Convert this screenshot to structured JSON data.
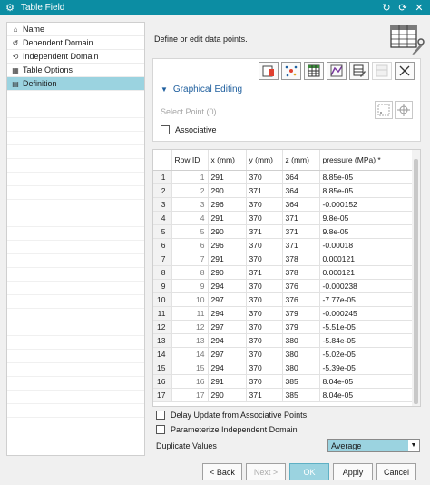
{
  "window": {
    "title": "Table Field"
  },
  "tree": {
    "items": [
      {
        "label": "Name",
        "icon": "tag-icon"
      },
      {
        "label": "Dependent Domain",
        "icon": "dependent-icon"
      },
      {
        "label": "Independent Domain",
        "icon": "independent-icon"
      },
      {
        "label": "Table Options",
        "icon": "table-options-icon"
      },
      {
        "label": "Definition",
        "icon": "definition-icon",
        "selected": true
      }
    ]
  },
  "main": {
    "description": "Define or edit data points.",
    "section_title": "Graphical Editing",
    "select_point": "Select Point (0)",
    "associative_label": "Associative"
  },
  "table": {
    "headers": [
      "",
      "Row ID",
      "x (mm)",
      "y (mm)",
      "z (mm)",
      "pressure (MPa) *"
    ],
    "rows": [
      [
        "1",
        "1",
        "291",
        "370",
        "364",
        "8.85e-05"
      ],
      [
        "2",
        "2",
        "290",
        "371",
        "364",
        "8.85e-05"
      ],
      [
        "3",
        "3",
        "296",
        "370",
        "364",
        "-0.000152"
      ],
      [
        "4",
        "4",
        "291",
        "370",
        "371",
        "9.8e-05"
      ],
      [
        "5",
        "5",
        "290",
        "371",
        "371",
        "9.8e-05"
      ],
      [
        "6",
        "6",
        "296",
        "370",
        "371",
        "-0.00018"
      ],
      [
        "7",
        "7",
        "291",
        "370",
        "378",
        "0.000121"
      ],
      [
        "8",
        "8",
        "290",
        "371",
        "378",
        "0.000121"
      ],
      [
        "9",
        "9",
        "294",
        "370",
        "376",
        "-0.000238"
      ],
      [
        "10",
        "10",
        "297",
        "370",
        "376",
        "-7.77e-05"
      ],
      [
        "11",
        "11",
        "294",
        "370",
        "379",
        "-0.000245"
      ],
      [
        "12",
        "12",
        "297",
        "370",
        "379",
        "-5.51e-05"
      ],
      [
        "13",
        "13",
        "294",
        "370",
        "380",
        "-5.84e-05"
      ],
      [
        "14",
        "14",
        "297",
        "370",
        "380",
        "-5.02e-05"
      ],
      [
        "15",
        "15",
        "294",
        "370",
        "380",
        "-5.39e-05"
      ],
      [
        "16",
        "16",
        "291",
        "370",
        "385",
        "8.04e-05"
      ],
      [
        "17",
        "17",
        "290",
        "371",
        "385",
        "8.04e-05"
      ]
    ]
  },
  "options": {
    "delay_update": "Delay Update from Associative Points",
    "parameterize": "Parameterize Independent Domain",
    "duplicate_label": "Duplicate Values",
    "duplicate_value": "Average"
  },
  "buttons": {
    "back": "< Back",
    "next": "Next >",
    "ok": "OK",
    "apply": "Apply",
    "cancel": "Cancel"
  },
  "colors": {
    "titlebar": "#0c8da3",
    "selection": "#9bd3e0",
    "section": "#1f5f9e"
  }
}
